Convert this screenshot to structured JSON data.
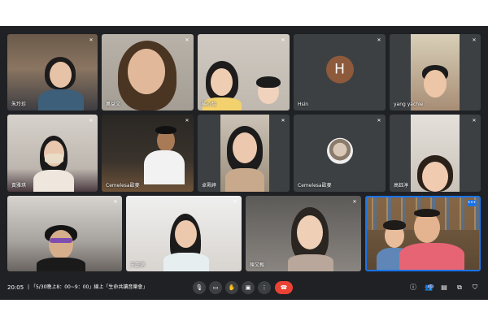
{
  "colors": {
    "background": "#202124",
    "tile": "#3c4043",
    "accent": "#1a73e8",
    "hangup": "#ea4335"
  },
  "participants": [
    {
      "name": "朱玲珍"
    },
    {
      "name": "萬益文"
    },
    {
      "name": "楊心怡"
    },
    {
      "name": "Hsin",
      "initial": "H"
    },
    {
      "name": "yang yachie"
    },
    {
      "name": "黃雅琪"
    },
    {
      "name": "Cemelesa歐麥"
    },
    {
      "name": "卓珮婷"
    },
    {
      "name": "Cemelesa歐麥"
    },
    {
      "name": "高鈺淳"
    },
    {
      "name": ""
    },
    {
      "name": "王慶錤"
    },
    {
      "name": "陳又甄"
    },
    {
      "name": ""
    }
  ],
  "bottom_bar": {
    "time": "20:05",
    "separator": "|",
    "meeting_title": "「5/30晚上8：00~9：00」線上「生命共讀音樂會」",
    "controls": [
      "mic-icon",
      "camera-icon",
      "raise-hand-icon",
      "present-icon",
      "more-options-icon",
      "hangup-icon"
    ],
    "right_icons": [
      "info-icon",
      "people-icon",
      "chat-icon",
      "activities-icon",
      "host-controls-icon"
    ],
    "people_count": "14"
  },
  "top_right_icons": [
    "captions-icon",
    "grid-icon",
    "window-icon",
    "edit-icon",
    "dark-icon",
    "emoji-icon"
  ]
}
